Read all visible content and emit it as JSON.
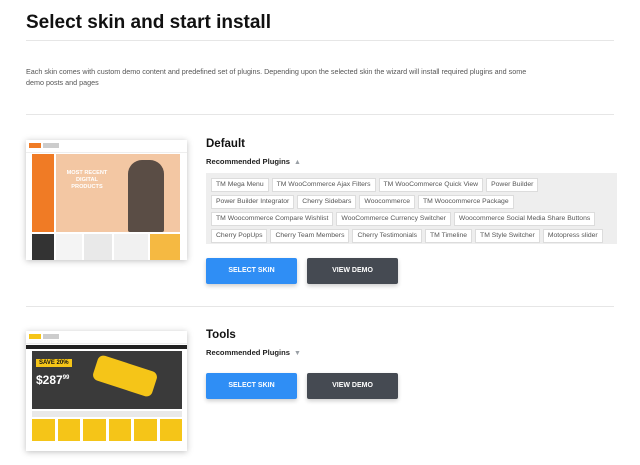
{
  "header": {
    "title": "Select skin and start install"
  },
  "intro": {
    "text": "Each skin comes with custom demo content and predefined set of plugins. Depending upon the selected skin the wizard will install required plugins and some demo posts and pages"
  },
  "skins": [
    {
      "name": "Default",
      "recommended_label": "Recommended Plugins",
      "expanded": true,
      "thumbnail_text": "MOST RECENT DIGITAL PRODUCTS",
      "plugins": [
        "TM Mega Menu",
        "TM WooCommerce Ajax Filters",
        "TM WooCommerce Quick View",
        "Power Builder",
        "Power Builder Integrator",
        "Cherry Sidebars",
        "Woocommerce",
        "TM Woocommerce Package",
        "TM Woocommerce Compare Wishlist",
        "WooCommerce Currency Switcher",
        "Woocommerce Social Media Share Buttons",
        "Cherry PopUps",
        "Cherry Team Members",
        "Cherry Testimonials",
        "TM Timeline",
        "TM Style Switcher",
        "Motopress slider"
      ],
      "select_label": "SELECT SKIN",
      "demo_label": "VIEW DEMO"
    },
    {
      "name": "Tools",
      "recommended_label": "Recommended Plugins",
      "expanded": false,
      "thumbnail_text": "SAVE 20%",
      "thumbnail_price": "$287",
      "thumbnail_price_cents": "99",
      "select_label": "SELECT SKIN",
      "demo_label": "VIEW DEMO"
    }
  ],
  "colors": {
    "accent": "#2f8ef5",
    "dark_button": "#454a52",
    "chip_panel": "#eeeeee",
    "default_brand": "#f07b25",
    "tools_brand": "#f5c518"
  },
  "icons": {
    "expanded": "triangle-up-icon",
    "collapsed": "triangle-down-icon"
  }
}
